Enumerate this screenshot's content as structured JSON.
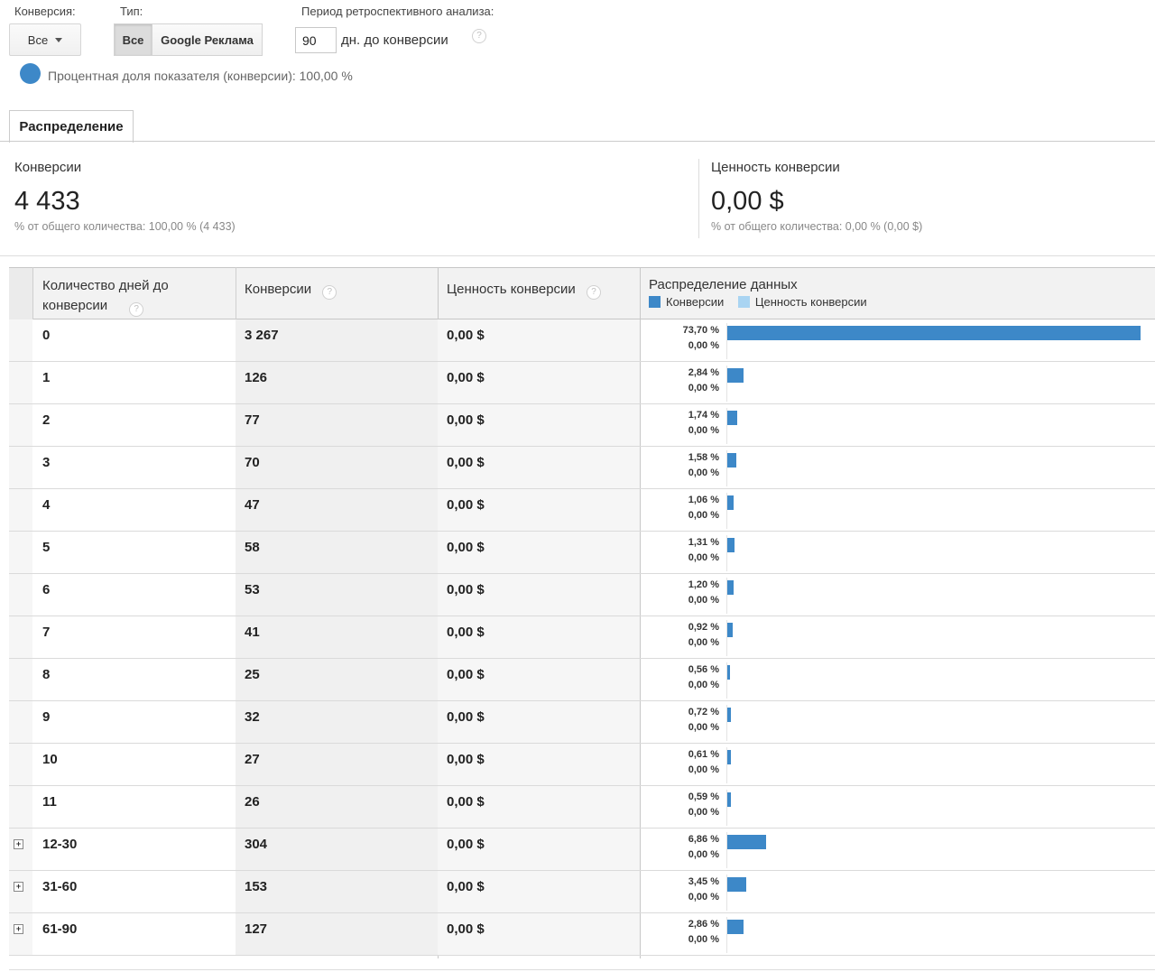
{
  "controls": {
    "conversion_label": "Конверсия:",
    "conversion_value": "Все",
    "type_label": "Тип:",
    "type_all": "Все",
    "type_google": "Google Реклама",
    "lookback_label": "Период ретроспективного анализа:",
    "lookback_value": "90",
    "lookback_suffix": "дн. до конверсии",
    "help": "?"
  },
  "metric_toggle": {
    "text": "Процентная доля показателя (конверсии): 100,00 %",
    "color": "#3d88c8"
  },
  "tabs": [
    {
      "label": "Распределение"
    }
  ],
  "summary": {
    "conversions": {
      "title": "Конверсии",
      "value": "4 433",
      "sub": "% от общего количества: 100,00 % (4 433)"
    },
    "value": {
      "title": "Ценность конверсии",
      "value": "0,00 $",
      "sub": "% от общего количества: 0,00 % (0,00 $)"
    }
  },
  "table": {
    "headers": {
      "days": "Количество дней до конверсии",
      "conversions": "Конверсии",
      "value": "Ценность конверсии",
      "distribution": "Распределение данных"
    },
    "legend": [
      {
        "name": "Конверсии",
        "color": "#3d88c8"
      },
      {
        "name": "Ценность конверсии",
        "color": "#a9d4f2"
      }
    ],
    "rows": [
      {
        "days": "0",
        "conversions": "3 267",
        "value": "0,00 $",
        "pct_conv": "73,70 %",
        "pct_val": "0,00 %",
        "share": 73.7,
        "expandable": false
      },
      {
        "days": "1",
        "conversions": "126",
        "value": "0,00 $",
        "pct_conv": "2,84 %",
        "pct_val": "0,00 %",
        "share": 2.84,
        "expandable": false
      },
      {
        "days": "2",
        "conversions": "77",
        "value": "0,00 $",
        "pct_conv": "1,74 %",
        "pct_val": "0,00 %",
        "share": 1.74,
        "expandable": false
      },
      {
        "days": "3",
        "conversions": "70",
        "value": "0,00 $",
        "pct_conv": "1,58 %",
        "pct_val": "0,00 %",
        "share": 1.58,
        "expandable": false
      },
      {
        "days": "4",
        "conversions": "47",
        "value": "0,00 $",
        "pct_conv": "1,06 %",
        "pct_val": "0,00 %",
        "share": 1.06,
        "expandable": false
      },
      {
        "days": "5",
        "conversions": "58",
        "value": "0,00 $",
        "pct_conv": "1,31 %",
        "pct_val": "0,00 %",
        "share": 1.31,
        "expandable": false
      },
      {
        "days": "6",
        "conversions": "53",
        "value": "0,00 $",
        "pct_conv": "1,20 %",
        "pct_val": "0,00 %",
        "share": 1.2,
        "expandable": false
      },
      {
        "days": "7",
        "conversions": "41",
        "value": "0,00 $",
        "pct_conv": "0,92 %",
        "pct_val": "0,00 %",
        "share": 0.92,
        "expandable": false
      },
      {
        "days": "8",
        "conversions": "25",
        "value": "0,00 $",
        "pct_conv": "0,56 %",
        "pct_val": "0,00 %",
        "share": 0.56,
        "expandable": false
      },
      {
        "days": "9",
        "conversions": "32",
        "value": "0,00 $",
        "pct_conv": "0,72 %",
        "pct_val": "0,00 %",
        "share": 0.72,
        "expandable": false
      },
      {
        "days": "10",
        "conversions": "27",
        "value": "0,00 $",
        "pct_conv": "0,61 %",
        "pct_val": "0,00 %",
        "share": 0.61,
        "expandable": false
      },
      {
        "days": "11",
        "conversions": "26",
        "value": "0,00 $",
        "pct_conv": "0,59 %",
        "pct_val": "0,00 %",
        "share": 0.59,
        "expandable": false
      },
      {
        "days": "12-30",
        "conversions": "304",
        "value": "0,00 $",
        "pct_conv": "6,86 %",
        "pct_val": "0,00 %",
        "share": 6.86,
        "expandable": true
      },
      {
        "days": "31-60",
        "conversions": "153",
        "value": "0,00 $",
        "pct_conv": "3,45 %",
        "pct_val": "0,00 %",
        "share": 3.45,
        "expandable": true
      },
      {
        "days": "61-90",
        "conversions": "127",
        "value": "0,00 $",
        "pct_conv": "2,86 %",
        "pct_val": "0,00 %",
        "share": 2.86,
        "expandable": true
      }
    ]
  }
}
